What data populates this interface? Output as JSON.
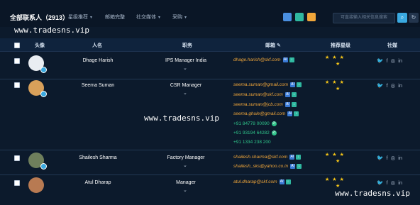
{
  "topbar": {
    "title": "全部联系人（2913）",
    "menus": [
      "星级推荐",
      "邮箱完整",
      "社交媒体",
      "采购"
    ],
    "search_placeholder": "可直接输入相关信息搜索"
  },
  "watermark": "www.tradesns.vip",
  "table": {
    "headers": {
      "avatar": "头像",
      "name": "人名",
      "position": "职务",
      "email": "邮箱",
      "rating": "推荐星级",
      "social": "社媒"
    },
    "rows": [
      {
        "name": "Dhage Harish",
        "position": "IPS Manager India",
        "emails": [
          "dhage.harish@skf.com"
        ],
        "phones": []
      },
      {
        "name": "Seema Suman",
        "position": "CSR Manager",
        "emails": [
          "seema.suman@gmail.com",
          "seema.suman@skf.com",
          "seema.suman@jcb.com",
          "seema.ghule@gmail.com"
        ],
        "phones": [
          "+91 84778 00090",
          "+91 93194 64282",
          "+91 1334 238 200"
        ]
      },
      {
        "name": "Shailesh Sharma",
        "position": "Factory Manager",
        "emails": [
          "shailesh.sharma@skf.com",
          "shailesh_sks@yahoo.co.in"
        ],
        "phones": []
      },
      {
        "name": "Atul Dharap",
        "position": "Manager",
        "emails": [
          "atul.dharap@skf.com"
        ],
        "phones": []
      }
    ]
  },
  "icons": {
    "star": "★",
    "chevron": "⌄",
    "twitter": "🐦",
    "facebook": "f",
    "instagram": "◎",
    "linkedin": "in",
    "search": "⌕",
    "refresh": "↻"
  },
  "colors": {
    "bg": "#0c1a2c",
    "email": "#f0a63a",
    "phone": "#2fc48a",
    "star": "#f5c518",
    "accent": "#3aa9e0"
  }
}
